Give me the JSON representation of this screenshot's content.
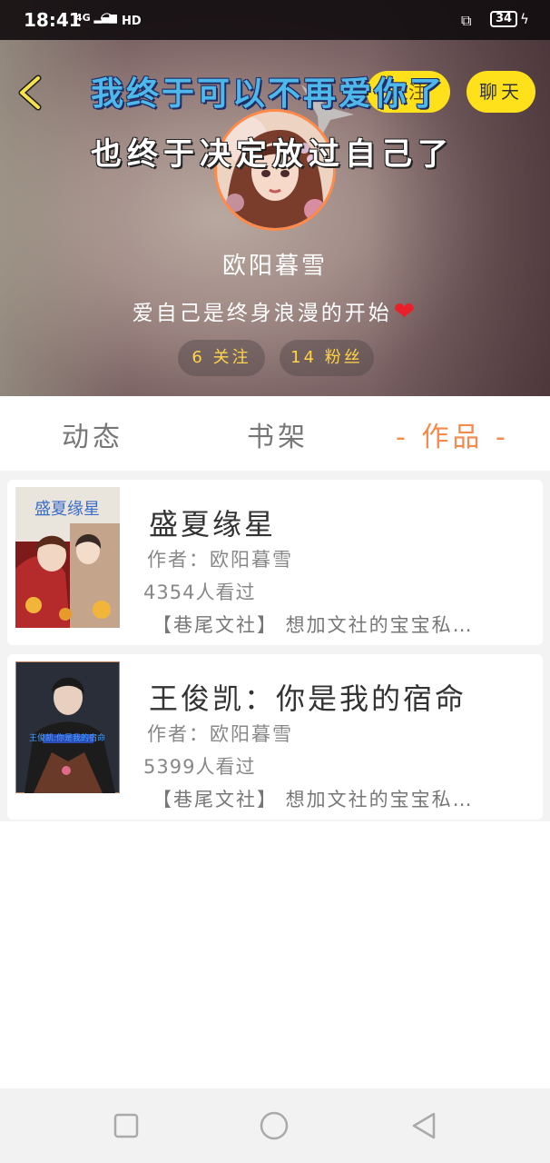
{
  "status_bar": {
    "time": "18:41",
    "network": "4G",
    "hd": "HD",
    "battery": "34"
  },
  "header": {
    "banner_line1": "我终于可以不再爱你了",
    "banner_line2": "也终于决定放过自己了",
    "follow_label": "关注",
    "chat_label": "聊天",
    "username": "欧阳暮雪",
    "bio": "爱自己是终身浪漫的开始",
    "heart": "❤",
    "following": "6 关注",
    "fans": "14 粉丝"
  },
  "tabs": [
    {
      "label": "动态",
      "active": false
    },
    {
      "label": "书架",
      "active": false
    },
    {
      "label": "- 作品 -",
      "active": true
    }
  ],
  "works": [
    {
      "title": "盛夏缘星",
      "author": "作者：欧阳暮雪",
      "views": "4354人看过",
      "desc": "【巷尾文社】 想加文社的宝宝私…",
      "cover_text": "盛夏缘星"
    },
    {
      "title": "王俊凯：你是我的宿命",
      "author": "作者：欧阳暮雪",
      "views": "5399人看过",
      "desc": "【巷尾文社】 想加文社的宝宝私…",
      "cover_text": "王俊凯:你是我的宿命"
    }
  ],
  "colors": {
    "accent_orange": "#f58a4a",
    "button_yellow": "#fee11a",
    "pill_text": "#ffd44a"
  },
  "icons": {
    "back": "chevron-left-icon",
    "nav_recent": "square-icon",
    "nav_home": "circle-icon",
    "nav_back": "triangle-left-icon"
  }
}
